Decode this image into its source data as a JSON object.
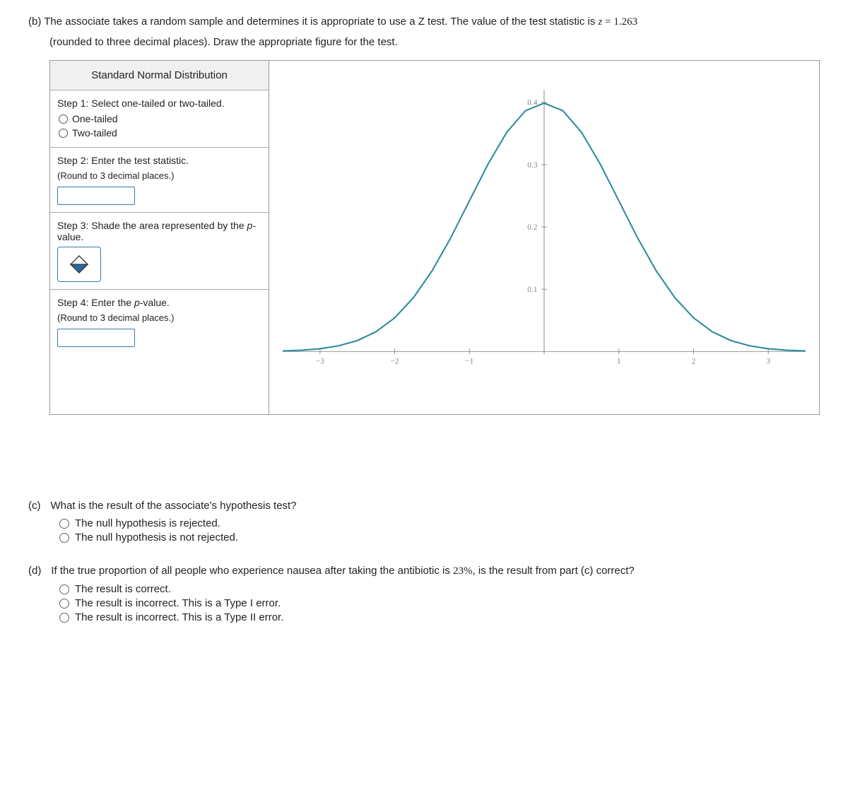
{
  "partB": {
    "label": "(b)",
    "line1_a": "The associate takes a random sample and determines it is appropriate to use a Z test. The value of the test statistic is ",
    "z_var": "z",
    "eq": " = ",
    "z_val": "1.263",
    "line2": "(rounded to three decimal places). Draw the appropriate figure for the test."
  },
  "panel": {
    "title": "Standard Normal Distribution",
    "step1": {
      "label": "Step 1: Select one-tailed or two-tailed.",
      "opt1": "One-tailed",
      "opt2": "Two-tailed"
    },
    "step2": {
      "label": "Step 2: Enter the test statistic.",
      "sub": "(Round to 3 decimal places.)"
    },
    "step3": {
      "label_a": "Step 3: Shade the area represented by the ",
      "p": "p",
      "label_b": "-value."
    },
    "step4": {
      "label_a": "Step 4: Enter the ",
      "p": "p",
      "label_b": "-value.",
      "sub": "(Round to 3 decimal places.)"
    }
  },
  "chart_data": {
    "type": "line",
    "title": "",
    "xlabel": "",
    "ylabel": "",
    "x_ticks": [
      -3,
      -2,
      -1,
      0,
      1,
      2,
      3
    ],
    "y_ticks": [
      0.1,
      0.2,
      0.3,
      0.4
    ],
    "xlim": [
      -3.5,
      3.5
    ],
    "ylim": [
      0,
      0.42
    ],
    "series": [
      {
        "name": "Standard Normal PDF",
        "x": [
          -3.5,
          -3.25,
          -3,
          -2.75,
          -2.5,
          -2.25,
          -2,
          -1.75,
          -1.5,
          -1.25,
          -1,
          -0.75,
          -0.5,
          -0.25,
          0,
          0.25,
          0.5,
          0.75,
          1,
          1.25,
          1.5,
          1.75,
          2,
          2.25,
          2.5,
          2.75,
          3,
          3.25,
          3.5
        ],
        "y": [
          0.0009,
          0.002,
          0.0044,
          0.0091,
          0.0175,
          0.0317,
          0.054,
          0.0863,
          0.1295,
          0.1826,
          0.242,
          0.3011,
          0.3521,
          0.3867,
          0.3989,
          0.3867,
          0.3521,
          0.3011,
          0.242,
          0.1826,
          0.1295,
          0.0863,
          0.054,
          0.0317,
          0.0175,
          0.0091,
          0.0044,
          0.002,
          0.0009
        ]
      }
    ]
  },
  "partC": {
    "label": "(c)",
    "question": "What is the result of the associate's hypothesis test?",
    "opt1": "The null hypothesis is rejected.",
    "opt2": "The null hypothesis is not rejected."
  },
  "partD": {
    "label": "(d)",
    "q_a": "If the true proportion of all people who experience nausea after taking the antibiotic is ",
    "pct": "23%",
    "q_b": ", is the result from part (c) correct?",
    "opt1": "The result is correct.",
    "opt2": "The result is incorrect. This is a Type I error.",
    "opt3": "The result is incorrect. This is a Type II error."
  }
}
